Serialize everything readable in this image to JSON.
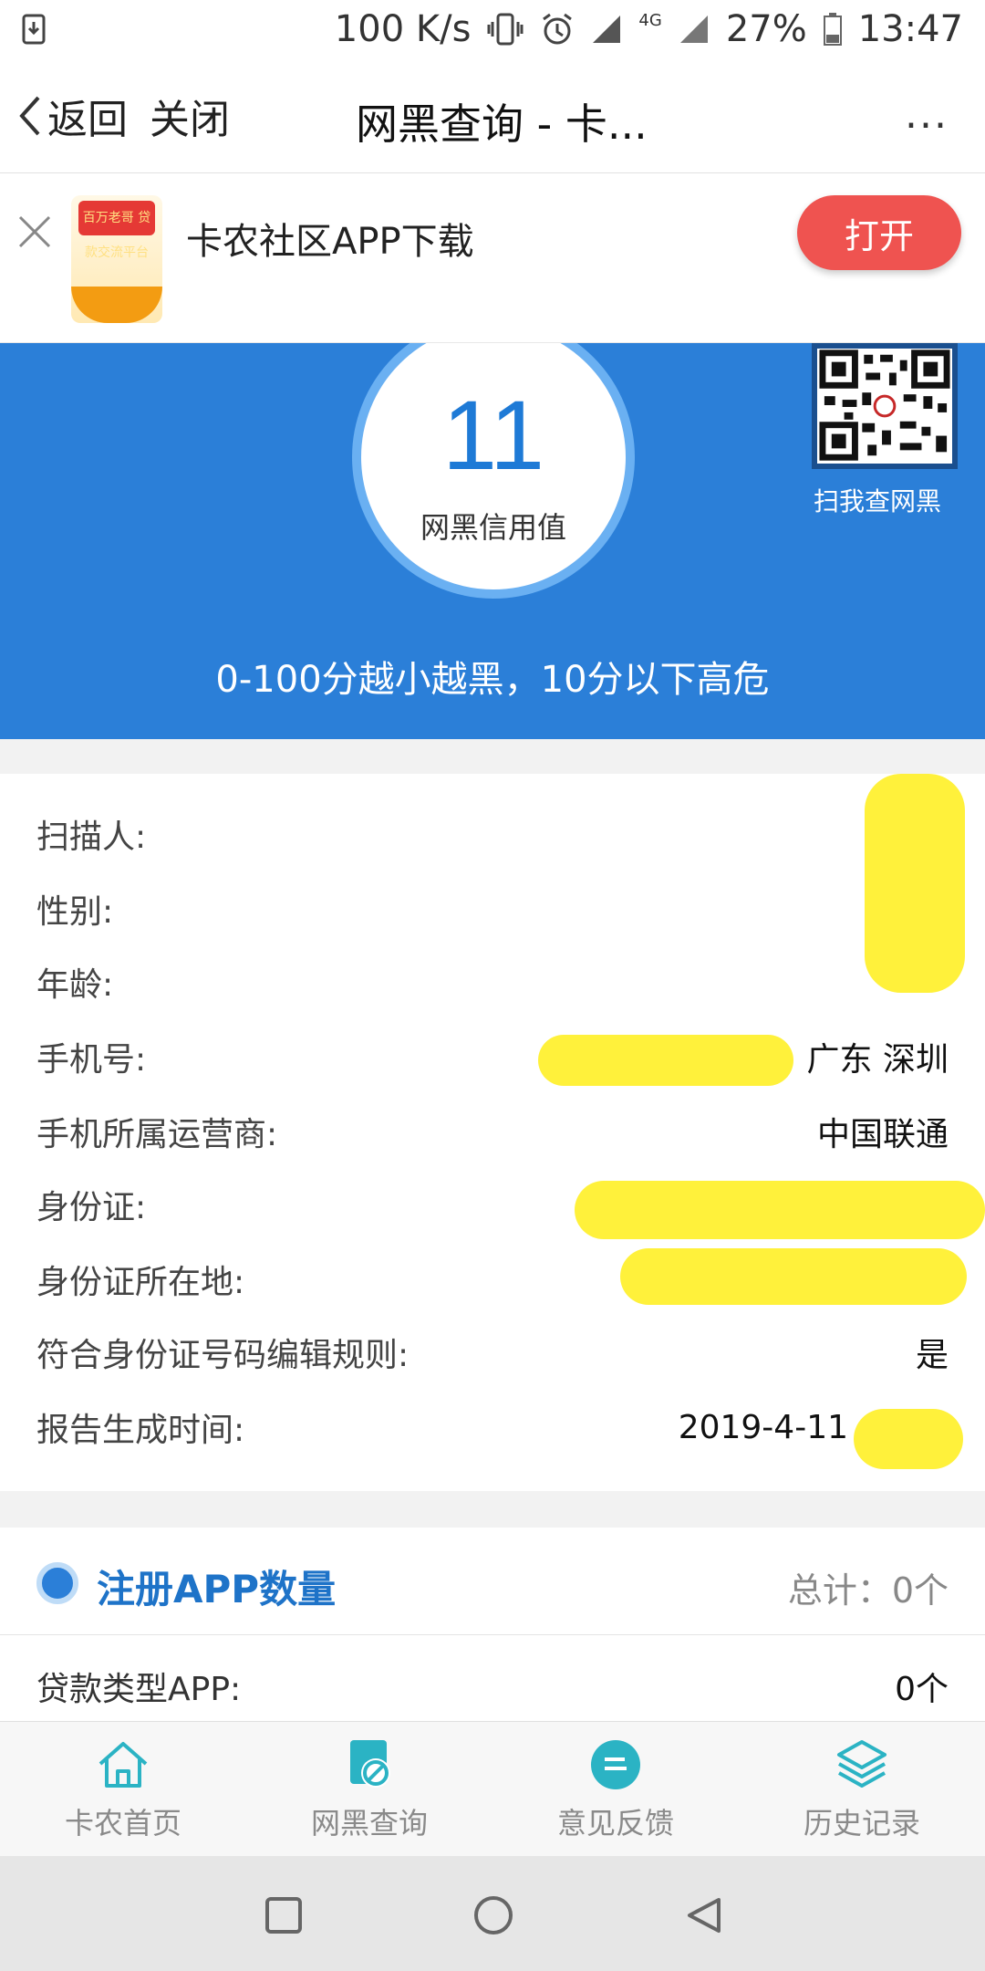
{
  "status_bar": {
    "speed": "100 K/s",
    "network": "4G",
    "battery": "27%",
    "time": "13:47"
  },
  "nav": {
    "back_label": "返回",
    "close_label": "关闭",
    "title": "网黑查询 - 卡...",
    "more_label": "..."
  },
  "banner": {
    "title": "卡农社区APP下载",
    "open_label": "打开",
    "logo_text": "百万老哥 贷款交流平台"
  },
  "hero": {
    "score": "11",
    "score_label": "网黑信用值",
    "qr_label": "扫我查网黑",
    "note": "0-100分越小越黑，10分以下高危",
    "bg_color": "#2b7fd8"
  },
  "info": {
    "rows": [
      {
        "label": "扫描人:",
        "value": ""
      },
      {
        "label": "性别:",
        "value": ""
      },
      {
        "label": "年龄:",
        "value": ""
      },
      {
        "label": "手机号:",
        "value": "广东 深圳"
      },
      {
        "label": "手机所属运营商:",
        "value": "中国联通"
      },
      {
        "label": "身份证:",
        "value": ""
      },
      {
        "label": "身份证所在地:",
        "value": ""
      },
      {
        "label": "符合身份证号码编辑规则:",
        "value": "是"
      },
      {
        "label": "报告生成时间:",
        "value": "2019-4-11"
      }
    ]
  },
  "apps": {
    "title": "注册APP数量",
    "total": "总计：0个",
    "loan_label": "贷款类型APP:",
    "loan_value": "0个"
  },
  "tabs": [
    {
      "label": "卡农首页",
      "icon": "home-icon"
    },
    {
      "label": "网黑查询",
      "icon": "blacklist-query-icon"
    },
    {
      "label": "意见反馈",
      "icon": "feedback-icon"
    },
    {
      "label": "历史记录",
      "icon": "history-layers-icon"
    }
  ]
}
